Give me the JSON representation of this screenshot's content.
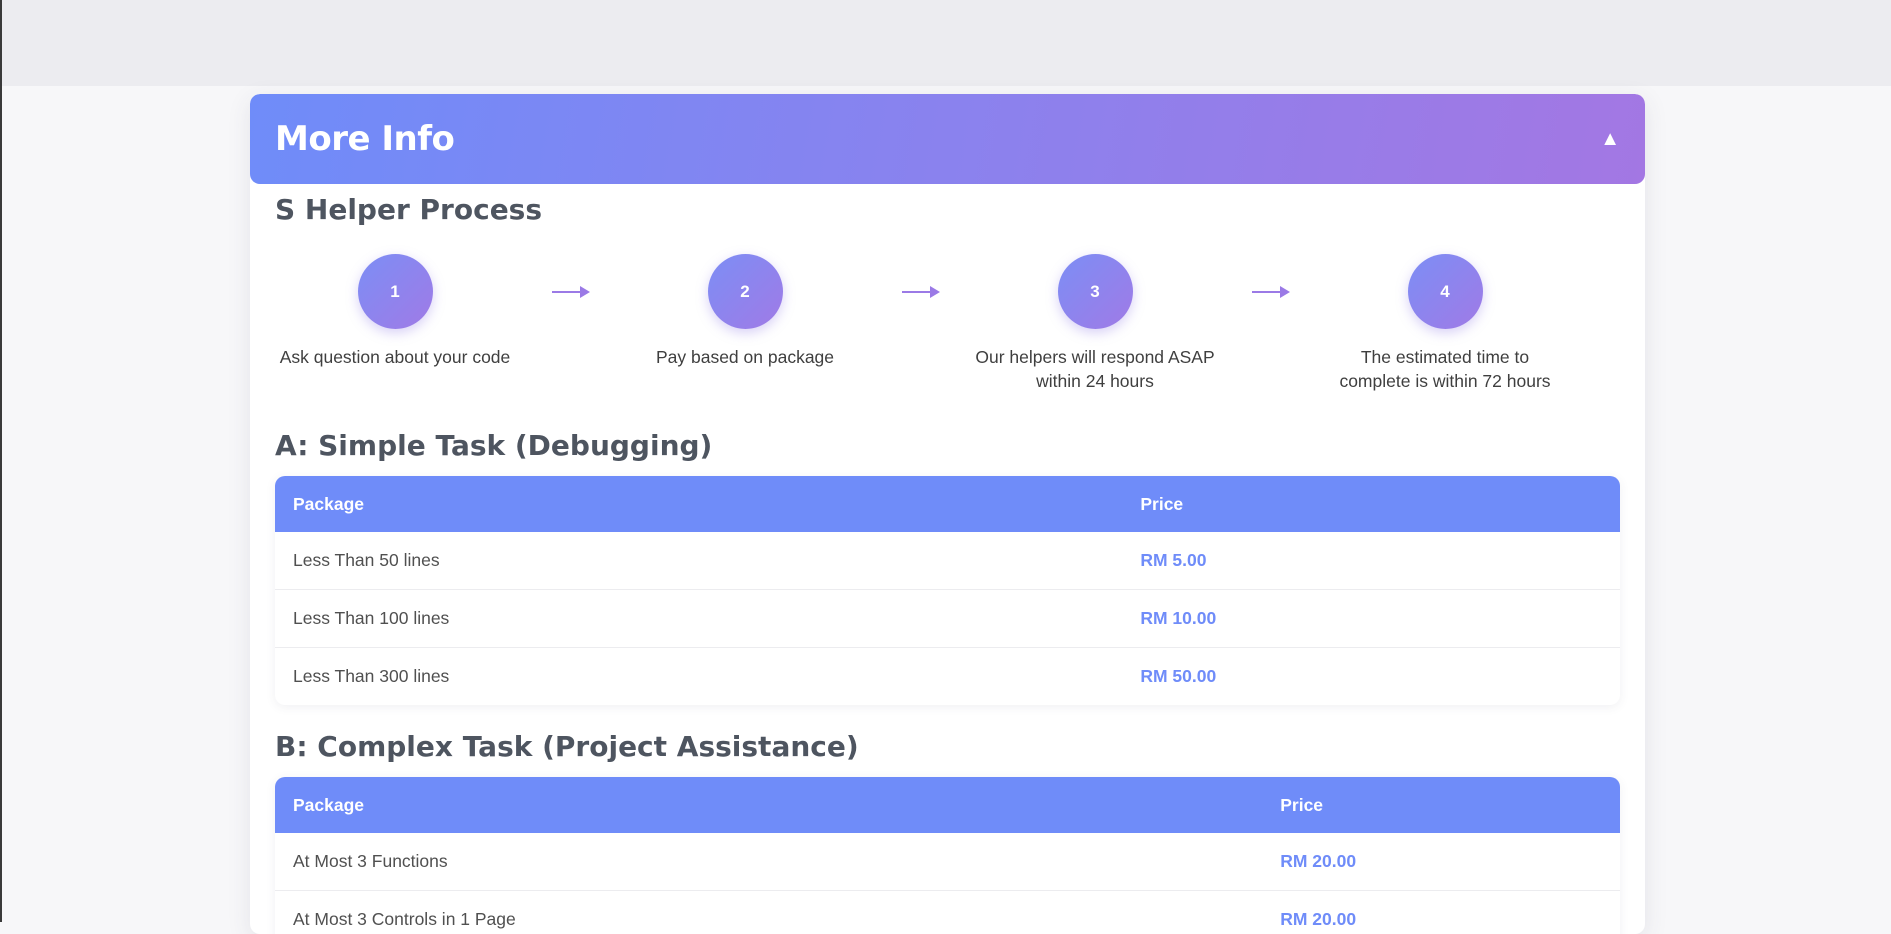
{
  "header": {
    "title": "More Info",
    "toggle_symbol": "▲"
  },
  "process": {
    "title": "S Helper Process",
    "steps": [
      {
        "number": "1",
        "text": "Ask question about your code"
      },
      {
        "number": "2",
        "text": "Pay based on package"
      },
      {
        "number": "3",
        "text": "Our helpers will respond ASAP within 24 hours"
      },
      {
        "number": "4",
        "text": "The estimated time to complete is within 72 hours"
      }
    ]
  },
  "simple_task": {
    "title": "A: Simple Task (Debugging)",
    "columns": [
      "Package",
      "Price"
    ],
    "rows": [
      {
        "package": "Less Than 50 lines",
        "price": "RM 5.00"
      },
      {
        "package": "Less Than 100 lines",
        "price": "RM 10.00"
      },
      {
        "package": "Less Than 300 lines",
        "price": "RM 50.00"
      }
    ]
  },
  "complex_task": {
    "title": "B: Complex Task (Project Assistance)",
    "columns": [
      "Package",
      "Price"
    ],
    "rows": [
      {
        "package": "At Most 3 Functions",
        "price": "RM 20.00"
      },
      {
        "package": "At Most 3 Controls in 1 Page",
        "price": "RM 20.00"
      }
    ]
  },
  "colors": {
    "accent": "#6f8cf9",
    "gradient_end": "#a377e3",
    "price_text": "#6f8cf9"
  }
}
